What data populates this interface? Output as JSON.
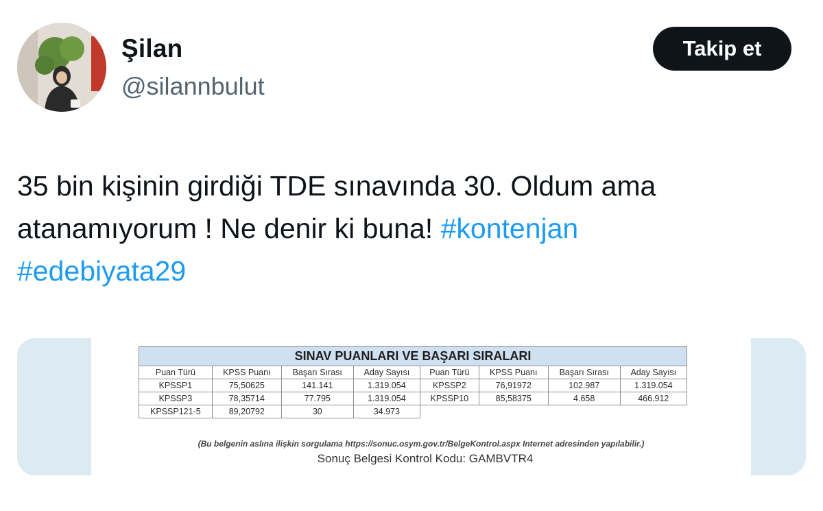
{
  "author": {
    "name": "Şilan",
    "handle": "@silannbulut"
  },
  "follow_button": {
    "label": "Takip et"
  },
  "tweet": {
    "line1": "35 bin kişinin girdiği TDE sınavında 30. Oldum ama",
    "line2_text": "atanamıyorum ! Ne denir ki buna!",
    "hashtag1": "#kontenjan",
    "hashtag2": "#edebiyata29"
  },
  "document": {
    "title": "SINAV PUANLARI VE BAŞARI SIRALARI",
    "headers": [
      "Puan Türü",
      "KPSS Puanı",
      "Başarı Sırası",
      "Aday Sayısı",
      "Puan Türü",
      "KPSS Puanı",
      "Başarı Sırası",
      "Aday Sayısı"
    ],
    "rows": [
      [
        "KPSSP1",
        "75,50625",
        "141.141",
        "1.319.054",
        "KPSSP2",
        "76,91972",
        "102.987",
        "1.319.054"
      ],
      [
        "KPSSP3",
        "78,35714",
        "77.795",
        "1.319.054",
        "KPSSP10",
        "85,58375",
        "4.658",
        "466.912"
      ],
      [
        "KPSSP121-5",
        "89,20792",
        "30",
        "34.973",
        "",
        "",
        "",
        ""
      ]
    ],
    "note": "(Bu belgenin aslına ilişkin sorgulama https://sonuc.osym.gov.tr/BelgeKontrol.aspx Internet adresinden yapılabilir.)",
    "control_code": "Sonuç Belgesi Kontrol Kodu: GAMBVTR4"
  },
  "colors": {
    "text": "#0f1419",
    "secondary": "#536471",
    "link": "#1d9bf0",
    "button_bg": "#0f1419",
    "table_title_bg": "#cfe0f1"
  }
}
